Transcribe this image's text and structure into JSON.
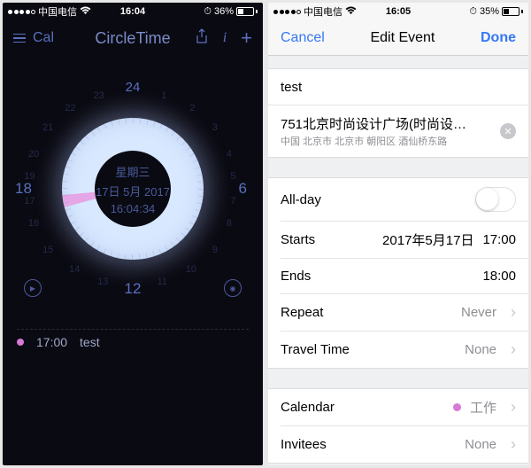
{
  "left": {
    "status": {
      "carrier": "中国电信",
      "time": "16:04",
      "battery_pct": "36%"
    },
    "nav": {
      "back_label": "Cal",
      "title": "CircleTime"
    },
    "dial": {
      "weekday": "星期三",
      "date_line": "17日  5月  2017",
      "time_line": "16:04:34",
      "h24": "24",
      "h6": "6",
      "h12": "12",
      "h18": "18",
      "h1": "1",
      "h2": "2",
      "h3": "3",
      "h4": "4",
      "h5": "5",
      "h7": "7",
      "h8": "8",
      "h9": "9",
      "h10": "10",
      "h11": "11",
      "h13": "13",
      "h14": "14",
      "h15": "15",
      "h16": "16",
      "h17": "17",
      "h19": "19",
      "h20": "20",
      "h21": "21",
      "h22": "22",
      "h23": "23"
    },
    "events": [
      {
        "time": "17:00",
        "title": "test"
      }
    ]
  },
  "right": {
    "status": {
      "carrier": "中国电信",
      "time": "16:05",
      "battery_pct": "35%"
    },
    "nav": {
      "cancel": "Cancel",
      "title": "Edit Event",
      "done": "Done"
    },
    "event": {
      "title": "test",
      "location_title": "751北京时尚设计广场(时尚设计…",
      "location_sub": "中国 北京市 北京市 朝阳区 酒仙桥东路",
      "allday_label": "All-day",
      "starts_label": "Starts",
      "starts_date": "2017年5月17日",
      "starts_time": "17:00",
      "ends_label": "Ends",
      "ends_time": "18:00",
      "repeat_label": "Repeat",
      "repeat_value": "Never",
      "travel_label": "Travel Time",
      "travel_value": "None",
      "calendar_label": "Calendar",
      "calendar_value": "工作",
      "invitees_label": "Invitees",
      "invitees_value": "None"
    }
  }
}
